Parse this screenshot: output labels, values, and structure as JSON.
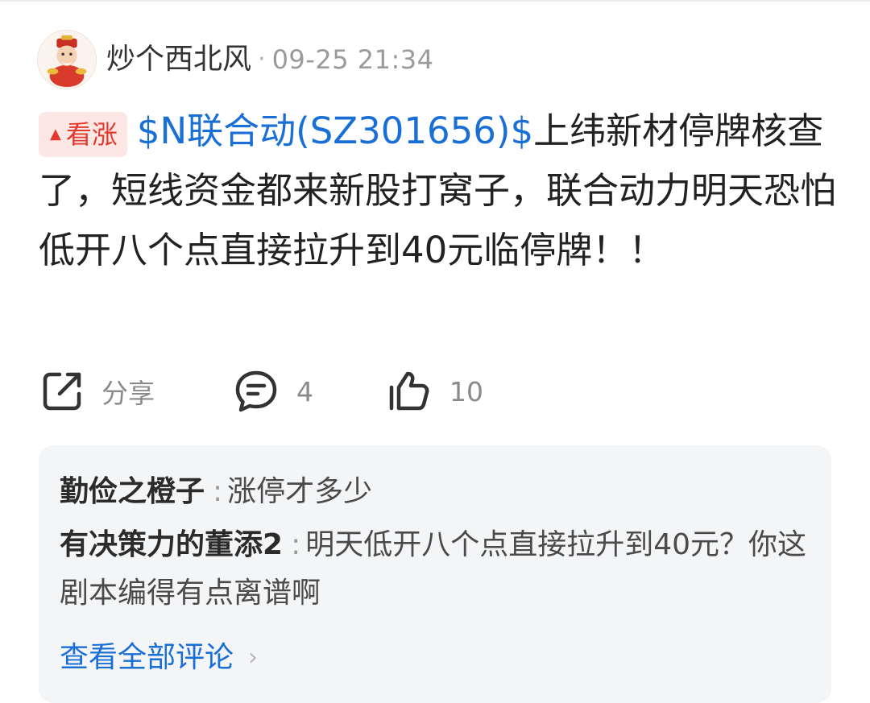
{
  "post": {
    "username": "炒个西北风",
    "separator": "·",
    "timestamp": "09-25 21:34",
    "badge": "看涨",
    "stock_link": "$N联合动(SZ301656)$",
    "text": "上纬新材停牌核查了，短线资金都来新股打窝子，联合动力明天恐怕低开八个点直接拉升到40元临停牌！！"
  },
  "actions": {
    "share_label": "分享",
    "comment_count": "4",
    "like_count": "10",
    "icons": [
      "share-icon",
      "comment-icon",
      "thumbs-up-icon"
    ]
  },
  "comments": {
    "items": [
      {
        "author": "勤俭之橙子",
        "separator": ":",
        "text": "涨停才多少"
      },
      {
        "author": "有决策力的董添2",
        "separator": ":",
        "text": "明天低开八个点直接拉升到40元？你这剧本编得有点离谱啊"
      }
    ],
    "view_all": "查看全部评论"
  },
  "colors": {
    "accent_blue": "#1a6fd6",
    "badge_red": "#e23b2e",
    "badge_bg": "#fde7e4",
    "comment_bg": "#f4f5f7"
  }
}
